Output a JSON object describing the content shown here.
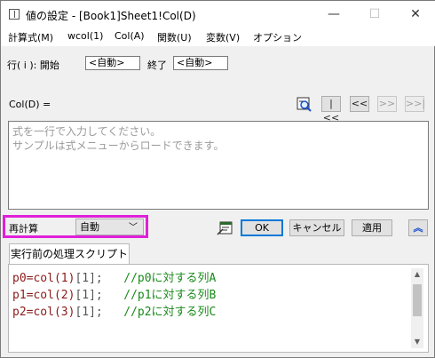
{
  "window": {
    "title": "値の設定 - [Book1]Sheet1!Col(D)"
  },
  "menu": [
    "計算式(M)",
    "wcol(1)",
    "Col(A)",
    "関数(U)",
    "変数(V)",
    "オプション"
  ],
  "row_range": {
    "label": "行( i ): 開始",
    "start_value": "<自動>",
    "end_label": "終了",
    "end_value": "<自動>"
  },
  "formula": {
    "label": "Col(D) =",
    "placeholder_line1": "式を一行で入力してください。",
    "placeholder_line2": "サンプルは式メニューからロードできます。"
  },
  "nav": {
    "first": "|<<",
    "prev": "<<",
    "next": ">>",
    "last": ">>|"
  },
  "recalc": {
    "label": "再計算",
    "value": "自動"
  },
  "buttons": {
    "ok": "OK",
    "cancel": "キャンセル",
    "apply": "適用",
    "collapse": "︽"
  },
  "script": {
    "tab_label": "実行前の処理スクリプト",
    "lines": [
      {
        "code": "p0=col(1)",
        "idx": "[1];",
        "comment": "//p0に対する列A"
      },
      {
        "code": "p1=col(2)",
        "idx": "[1];",
        "comment": "//p1に対する列B"
      },
      {
        "code": "p2=col(3)",
        "idx": "[1];",
        "comment": "//p2に対する列C"
      }
    ]
  },
  "colors": {
    "highlight": "#e020d8",
    "ok_border": "#0078d7",
    "comment": "#1a8a1a",
    "code": "#8b1a1a"
  }
}
